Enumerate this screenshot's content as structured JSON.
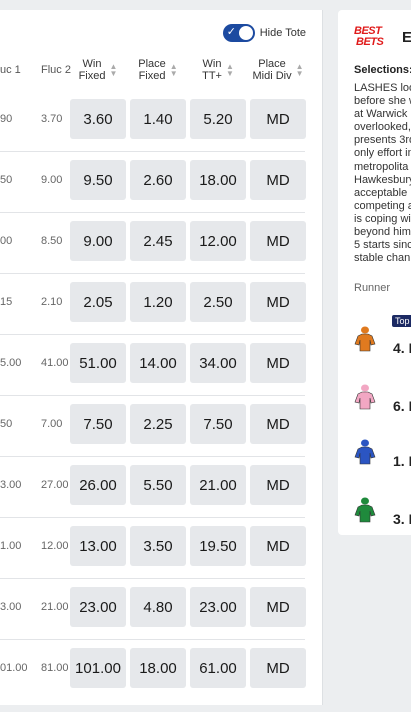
{
  "toggle": {
    "label": "Hide Tote",
    "checked": true
  },
  "headers": {
    "fluc1": "uc 1",
    "fluc2": "Fluc 2",
    "win_fixed": [
      "Win",
      "Fixed"
    ],
    "place_fixed": [
      "Place",
      "Fixed"
    ],
    "win_tt": [
      "Win",
      "TT+"
    ],
    "place_midi": [
      "Place",
      "Midi Div"
    ]
  },
  "rows": [
    {
      "fluc1": "90",
      "fluc2": "3.70",
      "win": "3.60",
      "place": "1.40",
      "tt": "5.20",
      "md": "MD"
    },
    {
      "fluc1": "50",
      "fluc2": "9.00",
      "win": "9.50",
      "place": "2.60",
      "tt": "18.00",
      "md": "MD"
    },
    {
      "fluc1": "00",
      "fluc2": "8.50",
      "win": "9.00",
      "place": "2.45",
      "tt": "12.00",
      "md": "MD"
    },
    {
      "fluc1": "15",
      "fluc2": "2.10",
      "win": "2.05",
      "place": "1.20",
      "tt": "2.50",
      "md": "MD"
    },
    {
      "fluc1": "5.00",
      "fluc2": "41.00",
      "win": "51.00",
      "place": "14.00",
      "tt": "34.00",
      "md": "MD"
    },
    {
      "fluc1": "50",
      "fluc2": "7.00",
      "win": "7.50",
      "place": "2.25",
      "tt": "7.50",
      "md": "MD"
    },
    {
      "fluc1": "3.00",
      "fluc2": "27.00",
      "win": "26.00",
      "place": "5.50",
      "tt": "21.00",
      "md": "MD"
    },
    {
      "fluc1": "1.00",
      "fluc2": "12.00",
      "win": "13.00",
      "place": "3.50",
      "tt": "19.50",
      "md": "MD"
    },
    {
      "fluc1": "3.00",
      "fluc2": "21.00",
      "win": "23.00",
      "place": "4.80",
      "tt": "23.00",
      "md": "MD"
    },
    {
      "fluc1": "01.00",
      "fluc2": "81.00",
      "win": "101.00",
      "place": "18.00",
      "tt": "61.00",
      "md": "MD"
    }
  ],
  "best_bets": {
    "logo_line1": "BEST",
    "logo_line2": "BETS",
    "title_letter": "E",
    "selections_label": "Selections:",
    "description_lines": [
      "LASHES loo",
      "before she w",
      "at Warwick",
      "overlooked,",
      "presents 3rd",
      "only effort in",
      "metropolita",
      "Hawkesbury",
      "acceptable",
      "competing a",
      "is coping wi",
      "beyond him",
      "5 starts sinc",
      "stable chan"
    ],
    "runner_header": "Runner",
    "top_badge": "Top",
    "runners": [
      {
        "label": "4. I",
        "jersey_color": "#e07a1f"
      },
      {
        "label": "6. I",
        "jersey_color": "#f2a7c3"
      },
      {
        "label": "1. I",
        "jersey_color": "#2b55c2"
      },
      {
        "label": "3. I",
        "jersey_color": "#1f8a3c"
      }
    ]
  },
  "colors": {
    "accent": "#1c4aa0",
    "button_bg": "#e6e8eb",
    "brand_red": "#e01a1a"
  }
}
